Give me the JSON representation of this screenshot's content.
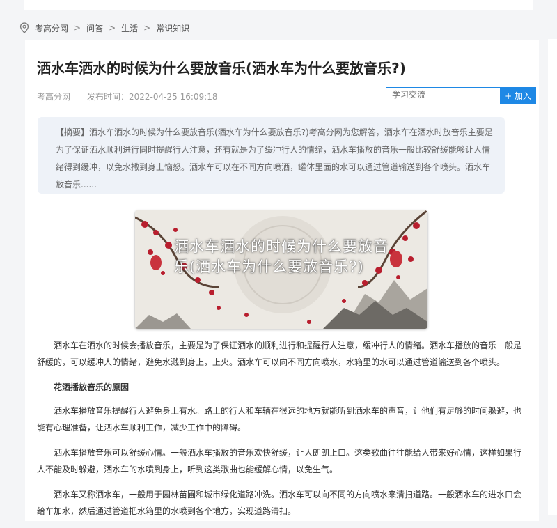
{
  "breadcrumb": {
    "items": [
      "考高分网",
      "问答",
      "生活",
      "常识知识"
    ],
    "separator": ">"
  },
  "article": {
    "title": "洒水车洒水的时候为什么要放音乐(洒水车为什么要放音乐?)",
    "source": "考高分网",
    "date_label": "发布时间：2022-04-25 16:09:18",
    "summary": "【摘要】洒水车洒水的时候为什么要放音乐(洒水车为什么要放音乐?)考高分网为您解答，洒水车在洒水时放音乐主要是为了保证洒水顺利进行同时提醒行人注意，还有就是为了缓冲行人的情绪，洒水车播放的音乐一般比较舒缓能够让人情绪得到缓冲，以免水撒到身上恼怒。洒水车可以在不同方向喷洒，罐体里面的水可以通过管道输送到各个喷头。洒水车放音乐......",
    "hero_caption": "洒水车洒水的时候为什么要放音乐(洒水车为什么要放音乐?)",
    "paragraphs": [
      "洒水车在洒水的时候会播放音乐，主要是为了保证洒水的顺利进行和提醒行人注意，缓冲行人的情绪。洒水车播放的音乐一般是舒缓的，可以缓冲人的情绪，避免水溅到身上，上火。洒水车可以向不同方向喷水，水箱里的水可以通过管道输送到各个喷头。",
      "洒水车播放音乐提醒行人避免身上有水。路上的行人和车辆在很远的地方就能听到洒水车的声音，让他们有足够的时间躲避，也能有心理准备，让洒水车顺利工作，减少工作中的障碍。",
      "洒水车播放音乐可以舒缓心情。一般洒水车播放的音乐欢快舒缓，让人朗朗上口。这类歌曲往往能给人带来好心情，这样如果行人不能及时躲避，洒水车的水喷到身上，听到这类歌曲也能缓解心情，以免生气。",
      "洒水车又称洒水车，一般用于园林苗圃和城市绿化道路冲洗。洒水车可以向不同的方向喷水来清扫道路。一般洒水车的进水口会给车加水，然后通过管道把水箱里的水喷到各个地方，实现道路清扫。"
    ],
    "subheading": "花洒播放音乐的原因"
  },
  "join": {
    "placeholder": "学习交流",
    "button_label": "+ 加入"
  },
  "colors": {
    "accent": "#1e88e5",
    "summary_bg": "#eef2f8",
    "page_bg": "#f4f5f7"
  },
  "icons": {
    "breadcrumb": "location-pin-icon"
  }
}
